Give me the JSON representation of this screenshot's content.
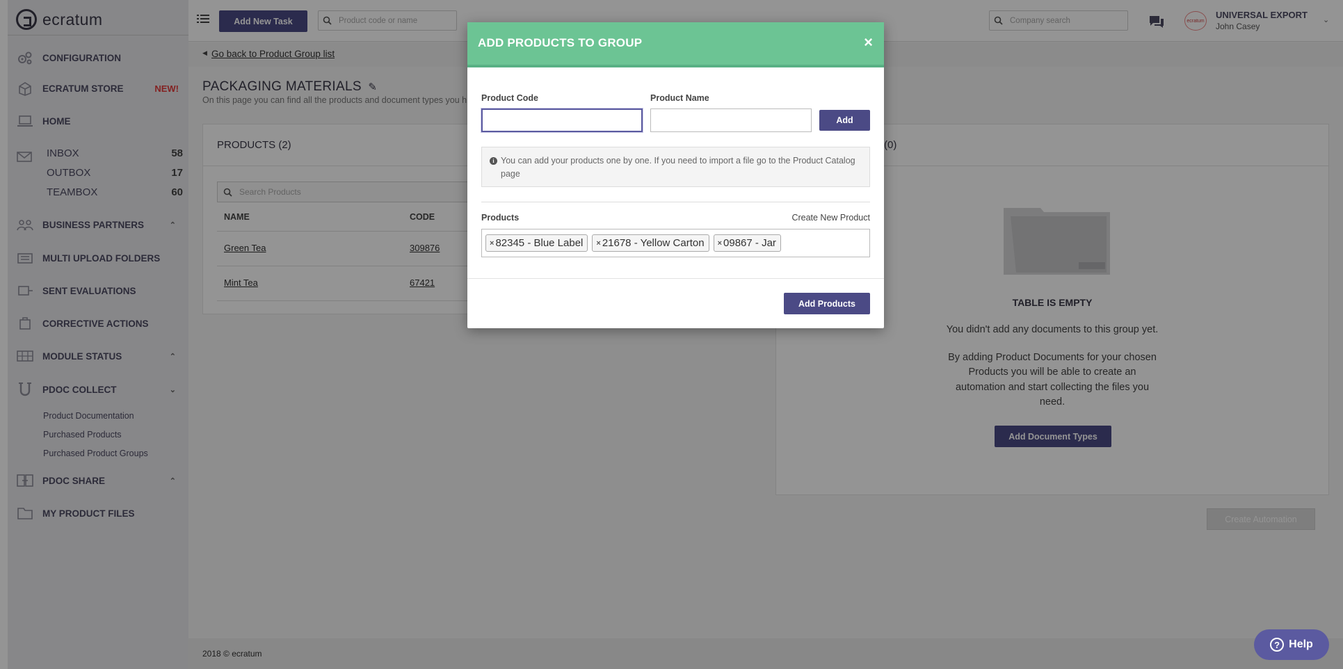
{
  "app": {
    "brand": "ecratum"
  },
  "sidebar": {
    "items": [
      {
        "label": "CONFIGURATION",
        "icon": "gears-icon"
      },
      {
        "label": "ECRATUM STORE",
        "icon": "store-icon",
        "badge": "NEW!"
      },
      {
        "label": "HOME",
        "icon": "laptop-icon"
      },
      {
        "label": "BUSINESS PARTNERS",
        "icon": "partners-icon"
      },
      {
        "label": "MULTI UPLOAD FOLDERS",
        "icon": "upload-folders-icon"
      },
      {
        "label": "SENT EVALUATIONS",
        "icon": "evaluations-icon"
      },
      {
        "label": "CORRECTIVE ACTIONS",
        "icon": "corrective-actions-icon"
      },
      {
        "label": "MODULE STATUS",
        "icon": "module-status-icon"
      },
      {
        "label": "PDOC COLLECT",
        "icon": "magnet-icon"
      },
      {
        "label": "PDOC SHARE",
        "icon": "share-icon"
      },
      {
        "label": "MY PRODUCT FILES",
        "icon": "product-files-icon"
      }
    ],
    "mailboxes": [
      {
        "label": "INBOX",
        "count": "58"
      },
      {
        "label": "OUTBOX",
        "count": "17"
      },
      {
        "label": "TEAMBOX",
        "count": "60"
      }
    ],
    "pdoc_collect_links": [
      "Product Documentation",
      "Purchased Products",
      "Purchased Product Groups"
    ]
  },
  "topbar": {
    "add_task": "Add New Task",
    "product_search_placeholder": "Product code or name",
    "company_search_placeholder": "Company search",
    "company_logo_text": "ecratum",
    "company_name": "UNIVERSAL EXPORT",
    "user_name": "John Casey"
  },
  "crumb": {
    "back": "Go back to Product Group list"
  },
  "page": {
    "title": "PACKAGING MATERIALS",
    "description": "On this page you can find all the products and document types you h"
  },
  "products_panel": {
    "title": "PRODUCTS (2)",
    "search_placeholder": "Search Products",
    "columns": [
      "NAME",
      "CODE"
    ],
    "rows": [
      {
        "name": "Green Tea",
        "code": "309876"
      },
      {
        "name": "Mint Tea",
        "code": "67421"
      }
    ]
  },
  "documents_panel": {
    "title_suffix": "(0)",
    "empty_title": "TABLE IS EMPTY",
    "empty_line1": "You didn't add any documents to this group yet.",
    "empty_line2": [
      "By adding Product Documents for your chosen",
      "Products you will be able to create an",
      "automation and start collecting the files you",
      "need."
    ],
    "add_doc_types": "Add Document Types",
    "create_automation": "Create Automation"
  },
  "modal": {
    "title": "ADD PRODUCTS TO GROUP",
    "close": "×",
    "code_label": "Product Code",
    "name_label": "Product Name",
    "add_label": "Add",
    "info_icon": "i",
    "info_text": "You can add your products one by one. If you need to import a file go to the Product Catalog page",
    "products_label": "Products",
    "create_new": "Create New Product",
    "tags": [
      "82345 - Blue Label",
      "21678 - Yellow Carton",
      "09867 - Jar"
    ],
    "tag_remove": "×",
    "submit": "Add Products"
  },
  "footer": {
    "text": "2018 © ecratum"
  },
  "help": {
    "label": "Help",
    "glyph": "?"
  },
  "colors": {
    "accent": "#4b4a85",
    "modal_header": "#6cc494",
    "new_badge": "#e23b3b"
  }
}
